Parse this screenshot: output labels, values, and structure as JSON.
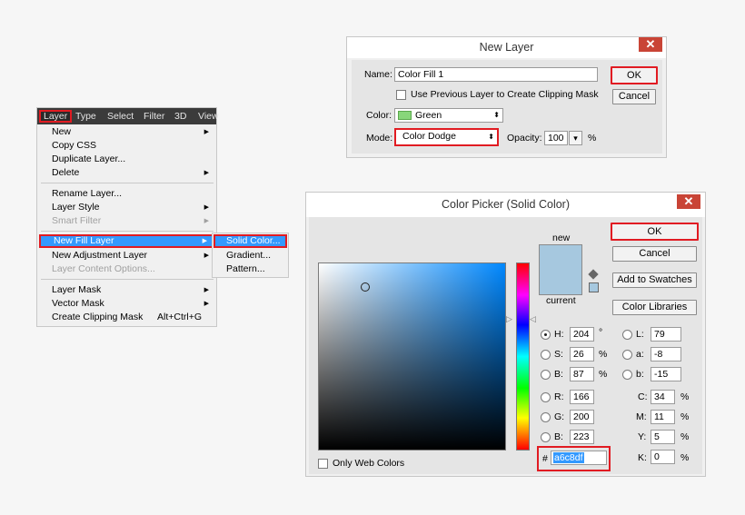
{
  "colors": {
    "accent_red": "#e11b22",
    "highlight": "#3399ff",
    "new_color": "#a6c8df",
    "current_color": "#a6c8df",
    "green_swatch": "#88d67a"
  },
  "layer_menu": {
    "menubar": [
      "Layer",
      "Type",
      "Select",
      "Filter",
      "3D",
      "View"
    ],
    "items": [
      {
        "label": "New",
        "submenu": true,
        "disabled": false
      },
      {
        "label": "Copy CSS",
        "submenu": false,
        "disabled": false
      },
      {
        "label": "Duplicate Layer...",
        "submenu": false,
        "disabled": false
      },
      {
        "label": "Delete",
        "submenu": true,
        "disabled": false
      },
      {
        "label": "Rename Layer...",
        "submenu": false,
        "disabled": false
      },
      {
        "label": "Layer Style",
        "submenu": true,
        "disabled": false
      },
      {
        "label": "Smart Filter",
        "submenu": true,
        "disabled": true
      },
      {
        "label": "New Fill Layer",
        "submenu": true,
        "disabled": false
      },
      {
        "label": "New Adjustment Layer",
        "submenu": true,
        "disabled": false
      },
      {
        "label": "Layer Content Options...",
        "submenu": false,
        "disabled": true
      },
      {
        "label": "Layer Mask",
        "submenu": true,
        "disabled": false
      },
      {
        "label": "Vector Mask",
        "submenu": true,
        "disabled": false
      },
      {
        "label": "Create Clipping Mask",
        "shortcut": "Alt+Ctrl+G",
        "submenu": false,
        "disabled": false
      }
    ],
    "submenu": [
      "Solid Color...",
      "Gradient...",
      "Pattern..."
    ],
    "arrow": "▶"
  },
  "new_layer": {
    "title": "New Layer",
    "close": "✕",
    "name_label": "Name:",
    "name_value": "Color Fill 1",
    "clipping_label": "Use Previous Layer to Create Clipping Mask",
    "color_label": "Color:",
    "color_value": "Green",
    "mode_label": "Mode:",
    "mode_value": "Color Dodge",
    "opacity_label": "Opacity:",
    "opacity_value": "100",
    "opacity_unit": "%",
    "ok": "OK",
    "cancel": "Cancel",
    "caret": "⬍",
    "down": "▾"
  },
  "color_picker": {
    "title": "Color Picker (Solid Color)",
    "close": "✕",
    "new_label": "new",
    "current_label": "current",
    "ok": "OK",
    "cancel": "Cancel",
    "add_swatches": "Add to Swatches",
    "color_libraries": "Color Libraries",
    "only_web_colors": "Only Web Colors",
    "hex_label": "#",
    "hex_value": "a6c8df",
    "hsb": [
      {
        "label": "H:",
        "value": "204",
        "unit": "°",
        "selected": true
      },
      {
        "label": "S:",
        "value": "26",
        "unit": "%",
        "selected": false
      },
      {
        "label": "B:",
        "value": "87",
        "unit": "%",
        "selected": false
      }
    ],
    "rgb": [
      {
        "label": "R:",
        "value": "166"
      },
      {
        "label": "G:",
        "value": "200"
      },
      {
        "label": "B:",
        "value": "223"
      }
    ],
    "lab": [
      {
        "label": "L:",
        "value": "79"
      },
      {
        "label": "a:",
        "value": "-8"
      },
      {
        "label": "b:",
        "value": "-15"
      }
    ],
    "cmyk": [
      {
        "label": "C:",
        "value": "34",
        "unit": "%"
      },
      {
        "label": "M:",
        "value": "11",
        "unit": "%"
      },
      {
        "label": "Y:",
        "value": "5",
        "unit": "%"
      },
      {
        "label": "K:",
        "value": "0",
        "unit": "%"
      }
    ]
  }
}
